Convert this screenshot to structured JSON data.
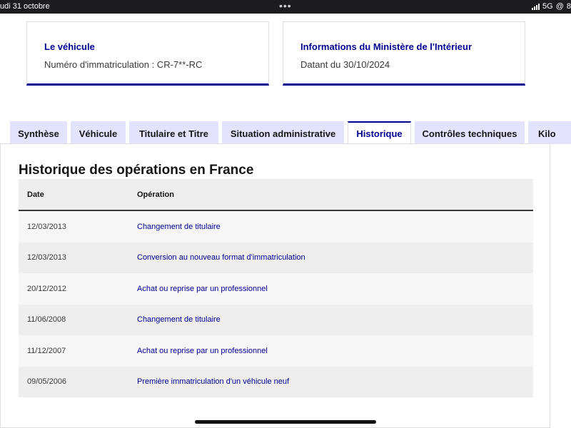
{
  "status_bar": {
    "date": "udi 31 octobre",
    "network": "5G",
    "at_symbol": "@",
    "battery_fragment": "8",
    "icons": [
      "signal-icon",
      "multitasking-dots-icon"
    ]
  },
  "cards": [
    {
      "title": "Le véhicule",
      "text": "Numéro d'immatriculation : CR-7**-RC"
    },
    {
      "title": "Informations du Ministère de l'Intérieur",
      "text": "Datant du 30/10/2024"
    }
  ],
  "tabs": [
    {
      "label": "Synthèse",
      "active": false
    },
    {
      "label": "Véhicule",
      "active": false
    },
    {
      "label": "Titulaire et Titre",
      "active": false
    },
    {
      "label": "Situation administrative",
      "active": false
    },
    {
      "label": "Historique",
      "active": true
    },
    {
      "label": "Contrôles techniques",
      "active": false
    },
    {
      "label": "Kilo",
      "active": false
    }
  ],
  "history": {
    "title": "Historique des opérations en France",
    "columns": [
      "Date",
      "Opération"
    ],
    "rows": [
      {
        "date": "12/03/2013",
        "operation": "Changement de titulaire"
      },
      {
        "date": "12/03/2013",
        "operation": "Conversion au nouveau format d'immatriculation"
      },
      {
        "date": "20/12/2012",
        "operation": "Achat ou reprise par un professionnel"
      },
      {
        "date": "11/06/2008",
        "operation": "Changement de titulaire"
      },
      {
        "date": "11/12/2007",
        "operation": "Achat ou reprise par un professionnel"
      },
      {
        "date": "09/05/2006",
        "operation": "Première immatriculation d'un véhicule neuf"
      }
    ]
  },
  "colors": {
    "accent": "#000091",
    "tab_bg": "#e3e3fd",
    "status_bar_bg": "#1c1c1e"
  }
}
